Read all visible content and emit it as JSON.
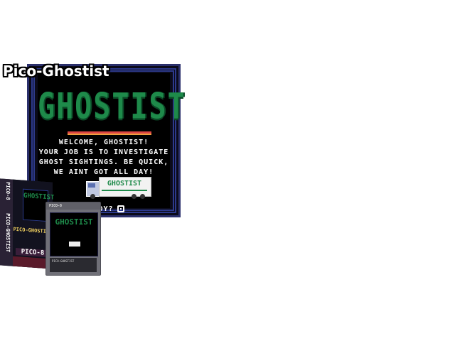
{
  "app": {
    "title": "Pico-Ghostist"
  },
  "game_screen": {
    "logo": "GHOSTIST",
    "message_lines": [
      "WELCOME, GHOSTIST!",
      "YOUR JOB IS TO INVESTIGATE",
      "GHOST SIGHTINGS. BE QUICK,",
      "WE AINT GOT ALL DAY!"
    ],
    "truck_label": "GHOSTIST",
    "prompt": "READY?",
    "prompt_icon": "o-button-icon"
  },
  "box_art": {
    "spine_brand": "PICO-8",
    "spine_title": "PICO-GHOSTIST",
    "front_logo": "GHOSTIST",
    "front_title": "PICO-GHOSTIST",
    "brand": "PICO-8"
  },
  "cartridge": {
    "brand": "PICO-8",
    "logo": "GHOSTIST",
    "label_title": "PICO-GHOSTIST",
    "label_author": "",
    "label_url": ""
  },
  "colors": {
    "logo_green": "#1e8a4a",
    "frame_blue": "#2d3a8c",
    "background": "#ffffff"
  }
}
